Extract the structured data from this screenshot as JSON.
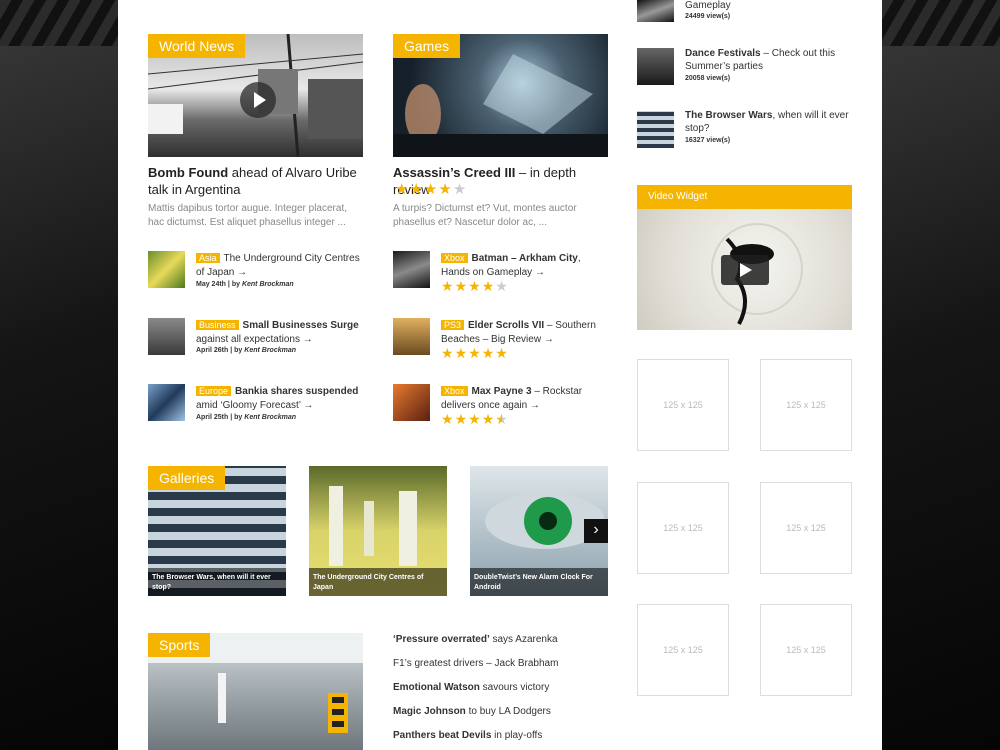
{
  "world_news": {
    "label": "World News",
    "main_title_bold": "Bomb Found",
    "main_title_rest": " ahead of Alvaro Uribe talk in Argentina",
    "excerpt": "Mattis dapibus tortor augue. Integer placerat, hac dictumst. Est aliquet phasellus integer ...",
    "items": [
      {
        "tag": "Asia",
        "title": "The Underground City Centres of Japan →",
        "date": "May 24th",
        "author": "Kent Brockman"
      },
      {
        "tag": "Business",
        "title_bold": "Small Businesses Surge",
        "title": "against all expectations →",
        "date": "April 26th",
        "author": "Kent Brockman"
      },
      {
        "tag": "Europe",
        "title_bold": "Bankia shares suspended",
        "title": "amid ‘Gloomy Forecast’ →",
        "date": "April 25th",
        "author": "Kent Brockman"
      }
    ],
    "by_prefix": " | by "
  },
  "games": {
    "label": "Games",
    "main_title_bold": "Assassin’s Creed III",
    "main_title_rest": " – in depth review",
    "rating": 4,
    "excerpt": "A turpis? Dictumst et? Vut, montes auctor phasellus et? Nascetur dolor ac, ...",
    "items": [
      {
        "tag": "Xbox",
        "title_bold": "Batman – Arkham City",
        "title": ", Hands on Gameplay →",
        "rating": 4
      },
      {
        "tag": "PS3",
        "title_bold": "Elder Scrolls VII",
        "title": " – Southern Beaches – Big Review →",
        "rating": 5
      },
      {
        "tag": "Xbox",
        "title_bold": "Max Payne 3",
        "title": " – Rockstar delivers once again →",
        "rating": 4.5
      }
    ]
  },
  "galleries": {
    "label": "Galleries",
    "items": [
      {
        "caption": "The Browser Wars, when will it ever stop?"
      },
      {
        "caption": "The Underground City Centres of Japan"
      },
      {
        "caption": "DoubleTwist’s New Alarm Clock For Android"
      }
    ],
    "next_arrow": "›"
  },
  "sports": {
    "label": "Sports",
    "items": [
      {
        "bold": "‘Pressure overrated’",
        "rest": " says Azarenka"
      },
      {
        "bold": "",
        "rest": "F1’s greatest drivers – Jack Brabham"
      },
      {
        "bold": "Emotional Watson",
        "rest": " savours victory"
      },
      {
        "bold": "Magic Johnson",
        "rest": " to buy LA Dodgers"
      },
      {
        "bold": "Panthers beat Devils",
        "rest": " in play-offs"
      }
    ]
  },
  "sidebar": {
    "popular": [
      {
        "bold": "",
        "rest": "Gameplay",
        "views": "24499 view(s)"
      },
      {
        "bold": "Dance Festivals",
        "rest": " – Check out this Summer’s parties",
        "views": "20058 view(s)"
      },
      {
        "bold": "The Browser Wars",
        "rest": ", when will it ever stop?",
        "views": "16327 view(s)"
      }
    ],
    "video_widget_label": "Video Widget",
    "ads": [
      "125 x 125",
      "125 x 125",
      "125 x 125",
      "125 x 125",
      "125 x 125",
      "125 x 125"
    ]
  },
  "colors": {
    "accent": "#f5b400"
  }
}
